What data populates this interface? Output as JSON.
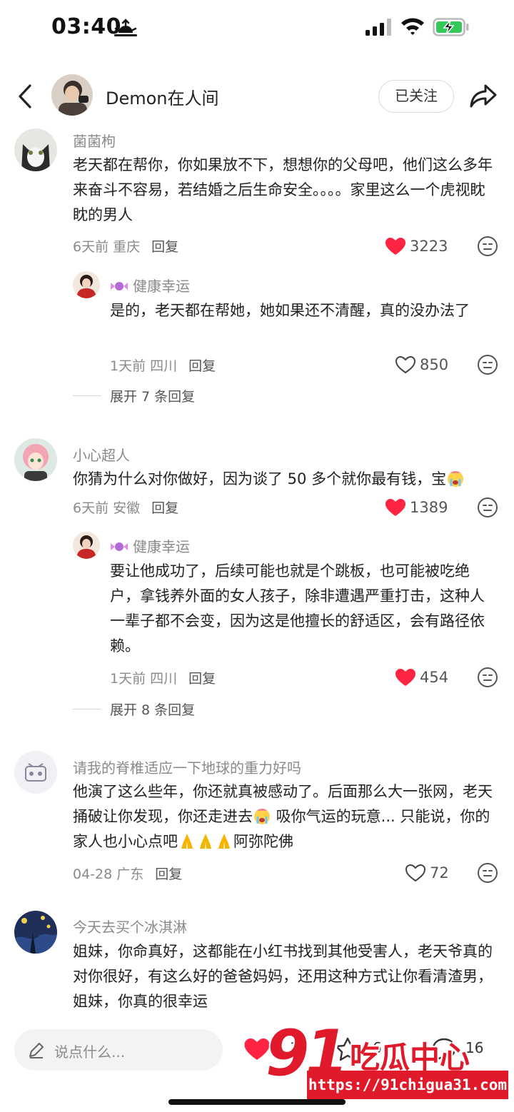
{
  "status_bar": {
    "time": "03:40"
  },
  "header": {
    "username": "Demon在人间",
    "follow_label": "已关注"
  },
  "comments": [
    {
      "user": "菌菌枸",
      "text": "老天都在帮你，你如果放不下，想想你的父母吧，他们这么多年来奋斗不容易，若结婚之后生命安全。。。。家里这么一个虎视眈眈的男人",
      "meta": "6天前 重庆",
      "reply_label": "回复",
      "likes": "3223",
      "liked": true,
      "reply": {
        "user": "健康幸运",
        "text": "是的，老天都在帮她，她如果还不清醒，真的没办法了",
        "meta": "1天前 四川",
        "reply_label": "回复",
        "likes": "850",
        "liked": false
      },
      "expand_label": "展开 7 条回复"
    },
    {
      "user": "小心超人",
      "text": "你猜为什么对你做好，因为谈了 50 多个就你最有钱，宝",
      "meta": "6天前 安徽",
      "reply_label": "回复",
      "likes": "1389",
      "liked": true,
      "reply": {
        "user": "健康幸运",
        "text": "要让他成功了，后续可能也就是个跳板，也可能被吃绝户，拿钱养外面的女人孩子，除非遭遇严重打击，这种人一辈子都不会变，因为这是他擅长的舒适区，会有路径依赖。",
        "meta": "1天前 四川",
        "reply_label": "回复",
        "likes": "454",
        "liked": true
      },
      "expand_label": "展开 8 条回复"
    },
    {
      "user": "请我的脊椎适应一下地球的重力好吗",
      "text_a": "他演了这么些年，你还就真被感动了。后面那么大一张网，老天捅破让你发现，你还走进去",
      "text_b": " 吸你气运的玩意... 只能说，你的家人也小心点吧",
      "text_c": "阿弥陀佛",
      "meta": "04-28 广东",
      "reply_label": "回复",
      "likes": "72",
      "liked": false
    },
    {
      "user": "今天去买个冰淇淋",
      "text": "姐妹，你命真好，这都能在小红书找到其他受害人，老天爷真的对你很好，有这么好的爸爸妈妈，还用这种方式让你看清渣男，姐妹，你真的很幸运"
    }
  ],
  "bottom_bar": {
    "input_placeholder": "说点什么...",
    "like_count": "1",
    "star_count": "6",
    "comment_count": "16"
  },
  "watermark": {
    "number": "91",
    "site_name": "吃瓜中心",
    "url": "https://91chigua31.com"
  },
  "colors": {
    "like_red": "#ff2442",
    "watermark_red": "#e11a2b",
    "meta_gray": "#8a8a8a"
  },
  "icons": [
    "sunset-icon",
    "signal-icon",
    "wifi-icon",
    "battery-charging-icon",
    "back-arrow-icon",
    "share-icon",
    "heart-icon",
    "emoji-icon",
    "pen-icon",
    "star-icon",
    "chat-icon",
    "candy-badge-icon",
    "crying-emoji-icon",
    "pray-emoji-icon"
  ]
}
